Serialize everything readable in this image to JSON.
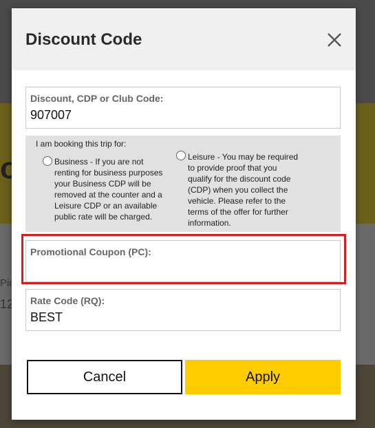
{
  "modal": {
    "title": "Discount Code",
    "close_icon": "close-icon"
  },
  "discount_field": {
    "label": "Discount, CDP or Club Code:",
    "value": "907007"
  },
  "booking": {
    "prompt": "I am booking this trip for:",
    "business_lines": [
      "Business - If you are not",
      "renting for business purposes",
      "your Business CDP will be",
      "removed at the counter and a",
      "Leisure CDP or an available",
      "public rate will be charged."
    ],
    "leisure_lines": [
      "Leisure - You may be required",
      "to provide proof that you",
      "qualify for the discount code",
      "(CDP) when you collect the",
      "vehicle. Please refer to the",
      "terms of the offer for further",
      "information."
    ]
  },
  "promo_field": {
    "label": "Promotional Coupon (PC):",
    "value": ""
  },
  "rate_field": {
    "label": "Rate Code (RQ):",
    "value": "BEST"
  },
  "buttons": {
    "cancel": "Cancel",
    "apply": "Apply"
  },
  "background": {
    "big_text": "o",
    "pi_text": "Pic",
    "num_text": "12"
  },
  "colors": {
    "accent_yellow": "#ffcc00",
    "highlight_red": "#d21f1f"
  }
}
